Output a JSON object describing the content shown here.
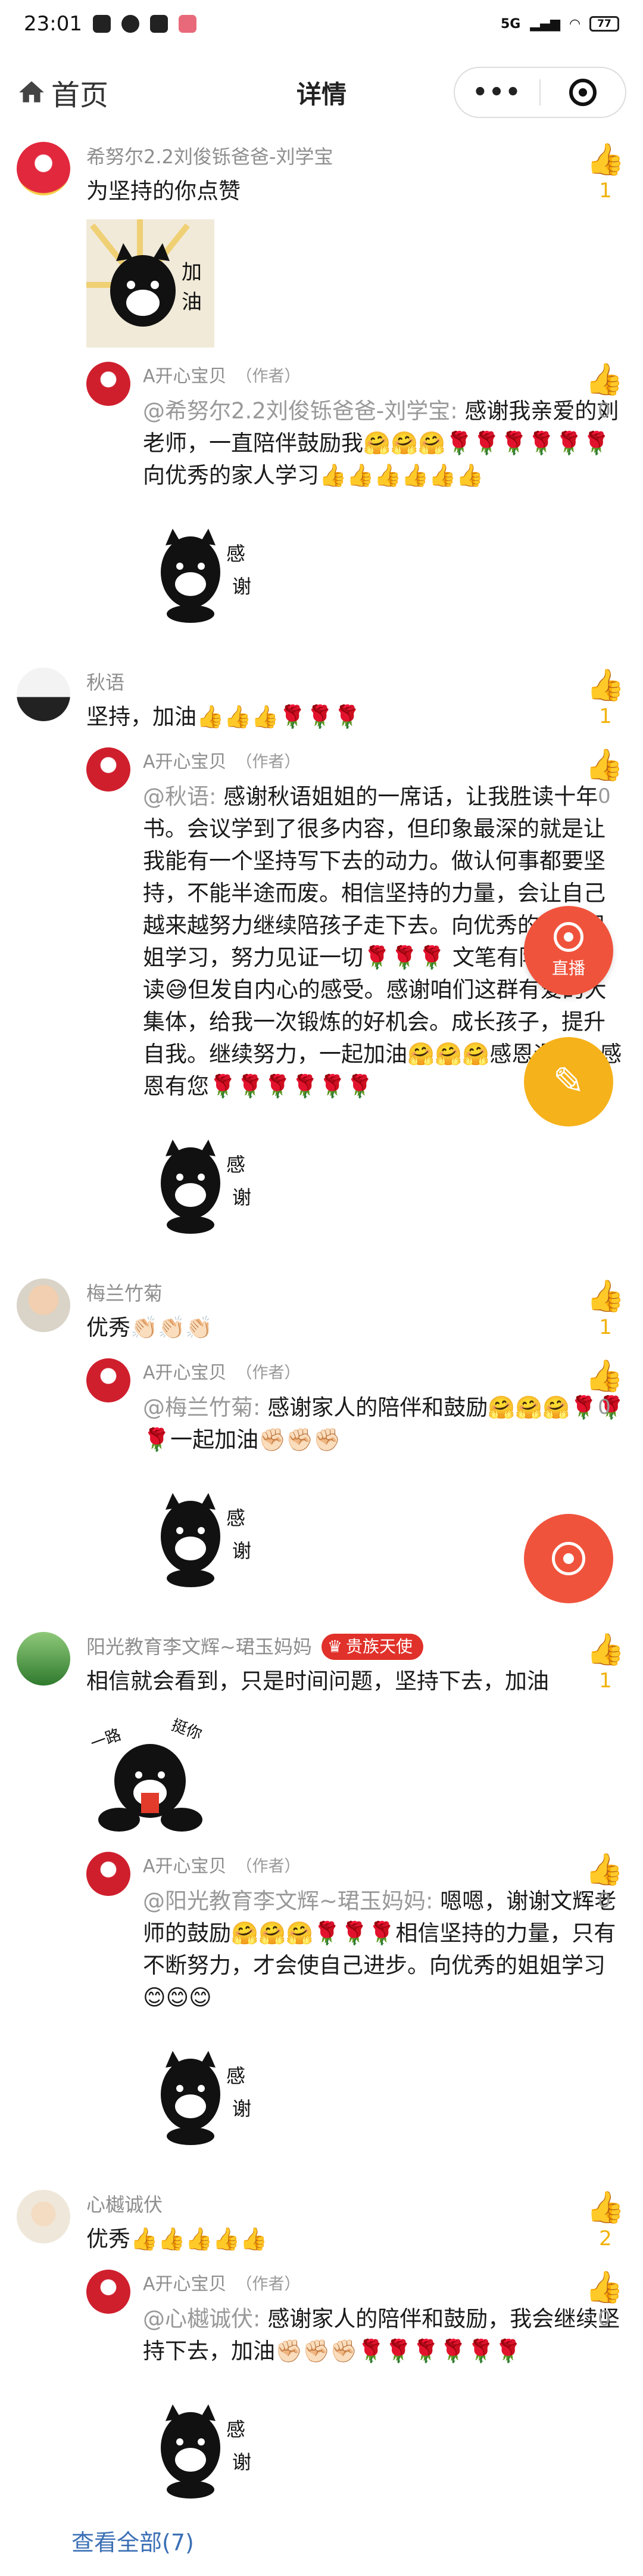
{
  "status": {
    "time": "23:01",
    "network": "5G",
    "battery": "77"
  },
  "nav": {
    "home_label": "首页",
    "title": "详情",
    "more_label": "•••"
  },
  "comments": [
    {
      "user": "希努尔2.2刘俊铄爸爸-刘学宝",
      "text": "为坚持的你点赞",
      "sticker_text": "加油",
      "likes": "1",
      "reply": {
        "user": "A开心宝贝",
        "tag": "（作者）",
        "mention": "@希努尔2.2刘俊铄爸爸-刘学宝:",
        "text": " 感谢我亲爱的刘老师，一直陪伴鼓励我🤗🤗🤗🌹🌹🌹🌹🌹🌹向优秀的家人学习👍👍👍👍👍👍",
        "sticker_text": "感谢",
        "likes": "0"
      }
    },
    {
      "user": "秋语",
      "text": "坚持，加油👍👍👍🌹🌹🌹",
      "likes": "1",
      "reply": {
        "user": "A开心宝贝",
        "tag": "（作者）",
        "mention": "@秋语:",
        "text": " 感谢秋语姐姐的一席话，让我胜读十年书。会议学到了很多内容，但印象最深的就是让我能有一个坚持写下去的动力。做认何事都要坚持，不能半途而废。相信坚持的力量，会让自己越来越努力继续陪孩子走下去。向优秀的秋语姐姐学习，努力见证一切🌹🌹🌹 文笔有限，究着读😅但发自内心的感受。感谢咱们这群有爱的大集体，给我一次锻炼的好机会。成长孩子，提升自我。继续努力，一起加油🤗🤗🤗感恩遇见，感恩有您🌹🌹🌹🌹🌹🌹",
        "sticker_text": "感谢",
        "likes": "0"
      }
    },
    {
      "user": "梅兰竹菊",
      "text": "优秀👏🏻👏🏻👏🏻",
      "likes": "1",
      "reply": {
        "user": "A开心宝贝",
        "tag": "（作者）",
        "mention": "@梅兰竹菊:",
        "text": " 感谢家人的陪伴和鼓励🤗🤗🤗🌹🌹🌹一起加油✊🏻✊🏻✊🏻",
        "sticker_text": "感谢",
        "likes": "0"
      }
    },
    {
      "user": "阳光教育李文辉~珺玉妈妈",
      "badge": "贵族天使",
      "text": "相信就会看到，只是时间问题，坚持下去，加油",
      "sticker_text": "一路挺你",
      "likes": "1",
      "reply": {
        "user": "A开心宝贝",
        "tag": "（作者）",
        "mention": "@阳光教育李文辉~珺玉妈妈:",
        "text": " 嗯嗯，谢谢文辉老师的鼓励🤗🤗🤗🌹🌹🌹相信坚持的力量，只有不断努力，才会使自己进步。向优秀的姐姐学习😊😊😊",
        "sticker_text": "感谢",
        "likes": "0"
      }
    },
    {
      "user": "心樾诚伏",
      "text": "优秀👍👍👍👍👍",
      "likes": "2",
      "reply": {
        "user": "A开心宝贝",
        "tag": "（作者）",
        "mention": "@心樾诚伏:",
        "text": " 感谢家人的陪伴和鼓励，我会继续坚持下去，加油✊🏻✊🏻✊🏻🌹🌹🌹🌹🌹🌹",
        "sticker_text": "感谢",
        "likes": "0"
      }
    }
  ],
  "float": {
    "live_label": "直播"
  },
  "footer": {
    "view_all": "查看全部(7)"
  }
}
